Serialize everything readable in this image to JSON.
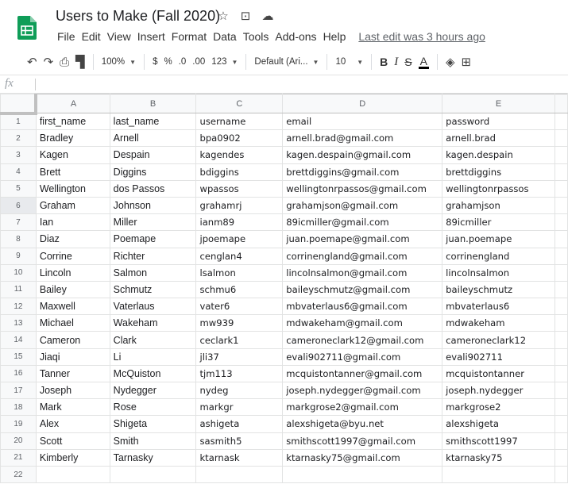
{
  "app": {
    "title": "Users to Make (Fall 2020)",
    "icons": [
      "star-icon",
      "move-to-folder-icon",
      "cloud-status-icon"
    ],
    "brand_color": "#0f9d58"
  },
  "menu": {
    "items": [
      "File",
      "Edit",
      "View",
      "Insert",
      "Format",
      "Data",
      "Tools",
      "Add-ons",
      "Help"
    ],
    "last_edit": "Last edit was 3 hours ago"
  },
  "toolbar": {
    "zoom": "100%",
    "currency": "$",
    "percent": "%",
    "decrease_decimal": ".0",
    "increase_decimal": ".00",
    "more_formats": "123",
    "font": "Default (Ari...",
    "font_size": "10",
    "bold": "B",
    "italic": "I",
    "strike": "S",
    "text_color": "A"
  },
  "formula": {
    "fx": "fx",
    "value": ""
  },
  "sheet": {
    "columns": [
      "A",
      "B",
      "C",
      "D",
      "E"
    ],
    "rows": [
      [
        "first_name",
        "last_name",
        "username",
        "email",
        "password"
      ],
      [
        "Bradley",
        "Arnell",
        "bpa0902",
        "arnell.brad@gmail.com",
        "arnell.brad"
      ],
      [
        "Kagen",
        "Despain",
        "kagendes",
        "kagen.despain@gmail.com",
        "kagen.despain"
      ],
      [
        "Brett",
        "Diggins",
        "bdiggins",
        "brettdiggins@gmail.com",
        "brettdiggins"
      ],
      [
        "Wellington",
        "dos Passos",
        "wpassos",
        "wellingtonrpassos@gmail.com",
        "wellingtonrpassos"
      ],
      [
        "Graham",
        "Johnson",
        "grahamrj",
        "grahamjson@gmail.com",
        "grahamjson"
      ],
      [
        "Ian",
        "Miller",
        "ianm89",
        "89icmiller@gmail.com",
        "89icmiller"
      ],
      [
        "Diaz",
        "Poemape",
        "jpoemape",
        "juan.poemape@gmail.com",
        "juan.poemape"
      ],
      [
        "Corrine",
        "Richter",
        "cenglan4",
        "corrinengland@gmail.com",
        "corrinengland"
      ],
      [
        "Lincoln",
        "Salmon",
        "lsalmon",
        "lincolnsalmon@gmail.com",
        "lincolnsalmon"
      ],
      [
        "Bailey",
        "Schmutz",
        "schmu6",
        "baileyschmutz@gmail.com",
        "baileyschmutz"
      ],
      [
        "Maxwell",
        "Vaterlaus",
        "vater6",
        "mbvaterlaus6@gmail.com",
        "mbvaterlaus6"
      ],
      [
        "Michael",
        "Wakeham",
        "mw939",
        "mdwakeham@gmail.com",
        "mdwakeham"
      ],
      [
        "Cameron",
        "Clark",
        "ceclark1",
        "cameroneclark12@gmail.com",
        "cameroneclark12"
      ],
      [
        "Jiaqi",
        "Li",
        "jli37",
        "evali902711@gmail.com",
        "evali902711"
      ],
      [
        "Tanner",
        "McQuiston",
        "tjm113",
        "mcquistontanner@gmail.com",
        "mcquistontanner"
      ],
      [
        "Joseph",
        "Nydegger",
        "nydeg",
        "joseph.nydegger@gmail.com",
        "joseph.nydegger"
      ],
      [
        "Mark",
        "Rose",
        "markgr",
        "markgrose2@gmail.com",
        "markgrose2"
      ],
      [
        "Alex",
        "Shigeta",
        "ashigeta",
        "alexshigeta@byu.net",
        "alexshigeta"
      ],
      [
        "Scott",
        "Smith",
        "sasmith5",
        "smithscott1997@gmail.com",
        "smithscott1997"
      ],
      [
        "Kimberly",
        "Tarnasky",
        "ktarnask",
        "ktarnasky75@gmail.com",
        "ktarnasky75"
      ],
      [
        "",
        "",
        "",
        "",
        ""
      ]
    ]
  }
}
